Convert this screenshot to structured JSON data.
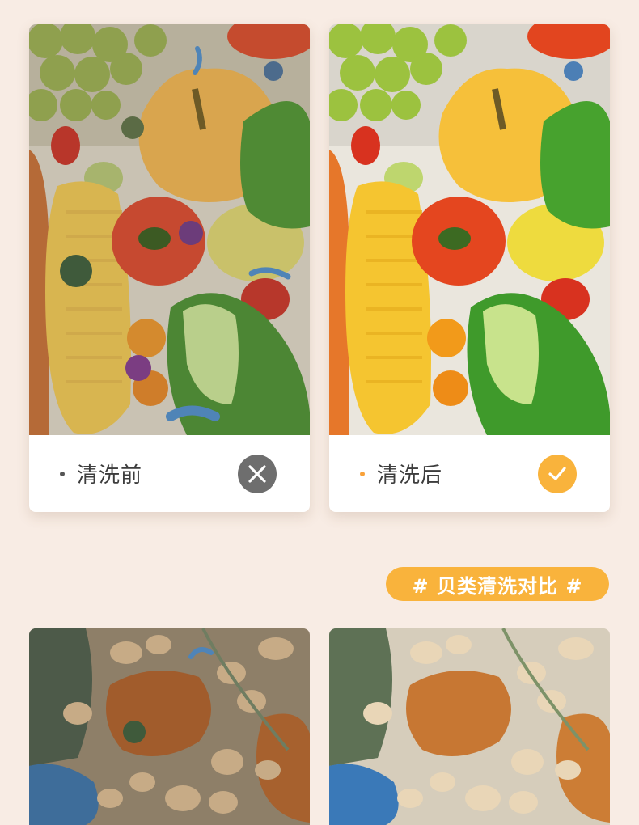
{
  "veg_comparison": {
    "before": {
      "label": "清洗前",
      "status_icon": "close-icon",
      "dot_color": "#555555",
      "badge_color": "#6e6e6e"
    },
    "after": {
      "label": "清洗后",
      "status_icon": "check-icon",
      "dot_color": "#f9a23a",
      "badge_color": "#f9b33c"
    }
  },
  "shellfish_section": {
    "tag": "# 贝类清洗对比 #"
  },
  "colors": {
    "page_bg": "#f8ece4",
    "accent": "#f9b33c"
  }
}
